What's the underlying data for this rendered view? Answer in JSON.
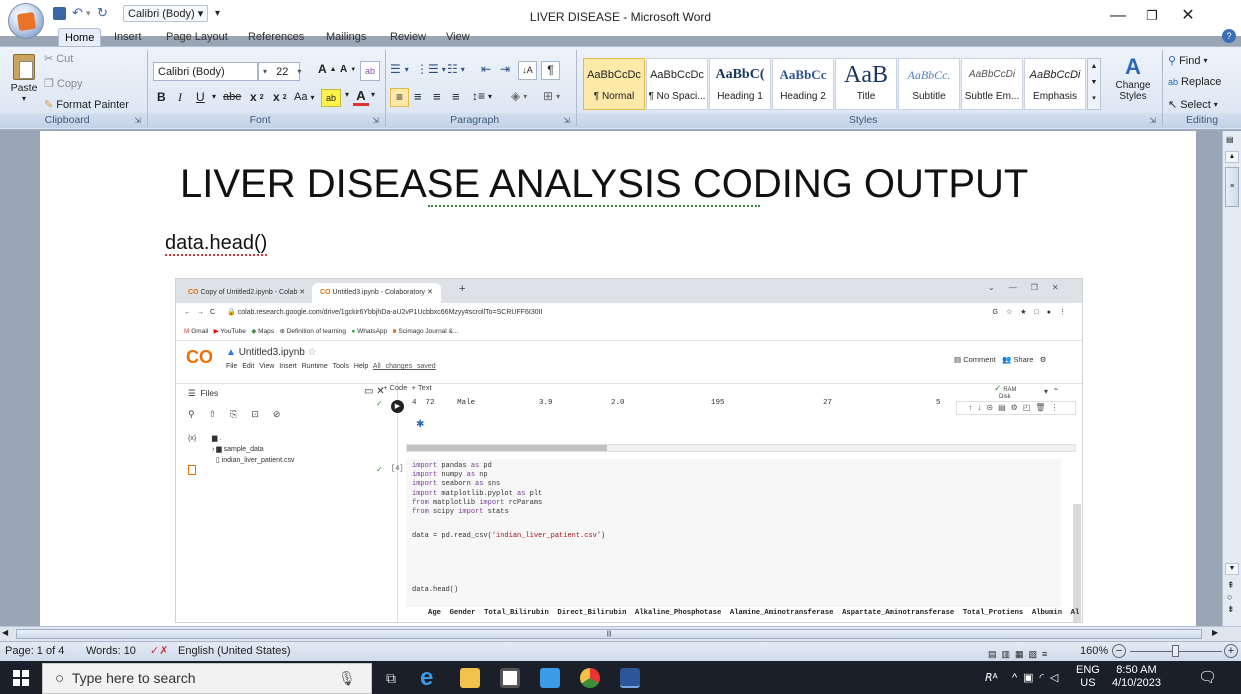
{
  "window": {
    "title": "LIVER DISEASE - Microsoft Word",
    "font_combo": "Calibri (Body)"
  },
  "tabs": [
    "Home",
    "Insert",
    "Page Layout",
    "References",
    "Mailings",
    "Review",
    "View"
  ],
  "ribbon": {
    "clipboard": {
      "paste": "Paste",
      "cut": "Cut",
      "copy": "Copy",
      "format_painter": "Format Painter",
      "label": "Clipboard"
    },
    "font": {
      "name": "Calibri (Body)",
      "size": "22",
      "bold": "B",
      "italic": "I",
      "underline": "U",
      "strike": "abe",
      "sub": "x",
      "sup": "x",
      "case": "Aa",
      "grow": "A",
      "shrink": "A",
      "label": "Font"
    },
    "paragraph": {
      "label": "Paragraph"
    },
    "styles": {
      "label": "Styles",
      "items": [
        {
          "sample": "AaBbCcDc",
          "name": "¶ Normal"
        },
        {
          "sample": "AaBbCcDc",
          "name": "¶ No Spaci..."
        },
        {
          "sample": "AaBbC(",
          "name": "Heading 1"
        },
        {
          "sample": "AaBbCc",
          "name": "Heading 2"
        },
        {
          "sample": "AaB",
          "name": "Title"
        },
        {
          "sample": "AaBbCc.",
          "name": "Subtitle"
        },
        {
          "sample": "AaBbCcDi",
          "name": "Subtle Em..."
        },
        {
          "sample": "AaBbCcDi",
          "name": "Emphasis"
        }
      ],
      "change_styles": "Change Styles"
    },
    "editing": {
      "find": "Find",
      "replace": "Replace",
      "select": "Select",
      "label": "Editing"
    }
  },
  "document": {
    "title": "LIVER DISEASE ANALYSIS  CODING OUTPUT",
    "subtitle": "data.head()"
  },
  "screenshot": {
    "tabs": [
      "Copy of Untitled2.ipynb - Colab",
      "Untitled3.ipynb - Colaboratory"
    ],
    "url": "colab.research.google.com/drive/1gckir6YbbjhDa-aU2vP1Ucbbxc66Mzyy#scrollTo=SCRUFF6I30II",
    "bookmarks": [
      "Gmail",
      "YouTube",
      "Maps",
      "Definition of learning",
      "WhatsApp",
      "Scimago Journal &..."
    ],
    "notebook": "Untitled3.ipynb",
    "menu": [
      "File",
      "Edit",
      "View",
      "Insert",
      "Runtime",
      "Tools",
      "Help"
    ],
    "saved": "All changes saved",
    "comment": "Comment",
    "share": "Share",
    "add_code": "+ Code",
    "add_text": "+ Text",
    "ram": "RAM",
    "disk": "Disk",
    "files_title": "Files",
    "tree": [
      ".",
      "sample_data",
      "indian_liver_patient.csv"
    ],
    "row": {
      "idx": "4",
      "age": "72",
      "gender": "Male",
      "v1": "3.9",
      "v2": "2.0",
      "v3": "195",
      "v4": "27",
      "v5": "5"
    },
    "cell_num": "[4]",
    "code": [
      [
        "import",
        " pandas ",
        "as",
        " pd"
      ],
      [
        "import",
        " numpy ",
        "as",
        " np"
      ],
      [
        "import",
        " seaborn ",
        "as",
        " sns"
      ],
      [
        "import",
        " matplotlib.pyplot ",
        "as",
        " plt"
      ],
      [
        "from",
        " matplotlib ",
        "import",
        " rcParams"
      ],
      [
        "from",
        " scipy ",
        "import",
        " stats"
      ]
    ],
    "read_line": "data = pd.read_csv(",
    "read_arg": "'indian_liver_patient.csv'",
    "read_end": ")",
    "head_line": "data.head()",
    "columns": "Age  Gender  Total_Bilirubin  Direct_Bilirubin  Alkaline_Phosphotase  Alamine_Aminotransferase  Aspartate_Aminotransferase  Total_Protiens  Albumin  Al"
  },
  "status": {
    "page": "Page: 1 of 4",
    "words": "Words: 10",
    "lang": "English (United States)",
    "zoom": "160%"
  },
  "taskbar": {
    "search": "Type here to search",
    "lang1": "ENG",
    "lang2": "US",
    "time": "8:50 AM",
    "date": "4/10/2023"
  },
  "colors": {
    "accent": "#2b579a",
    "ribbon": "#dfe8f4",
    "taskbar": "#1b1f2a"
  }
}
